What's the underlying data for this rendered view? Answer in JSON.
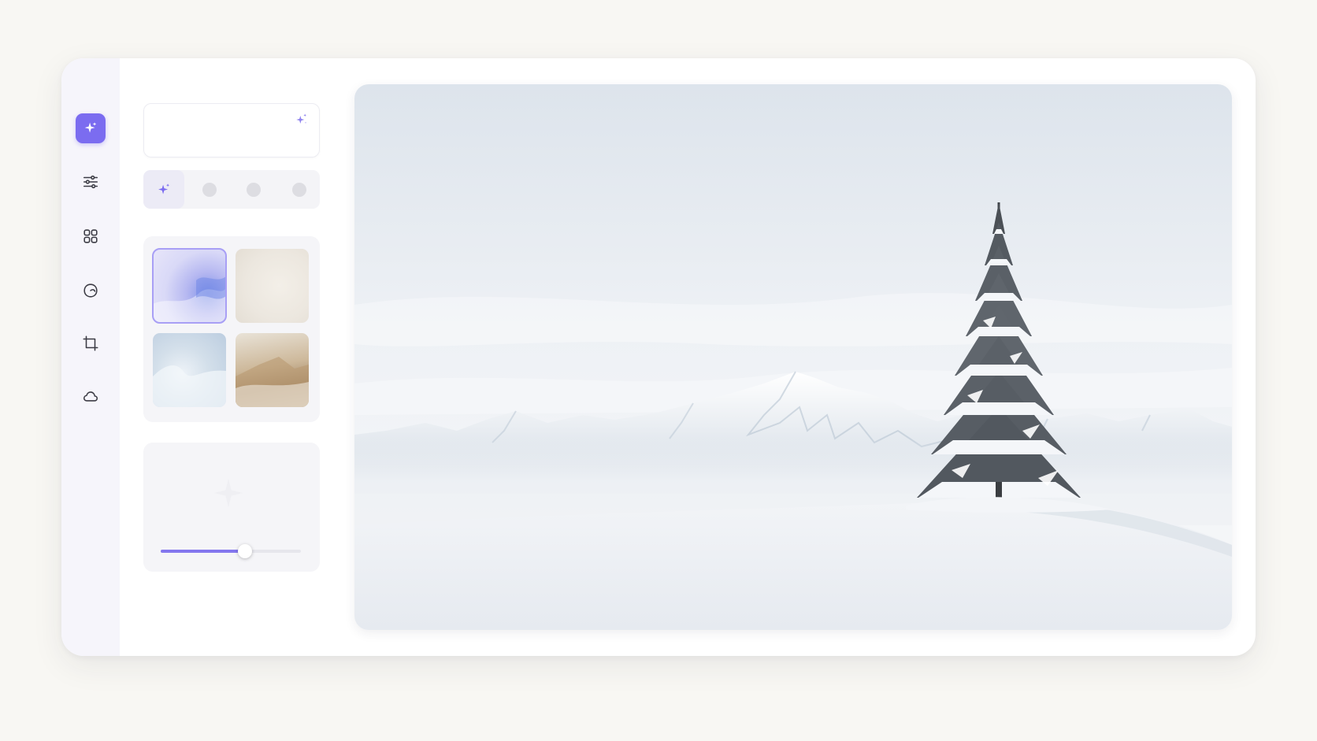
{
  "window": {
    "accent_color": "#7b6cf0"
  },
  "rail": {
    "items": [
      {
        "icon": "sparkle-icon",
        "active": true
      },
      {
        "icon": "sliders-icon",
        "active": false
      },
      {
        "icon": "grid-icon",
        "active": false
      },
      {
        "icon": "blob-shape-icon",
        "active": false
      },
      {
        "icon": "crop-icon",
        "active": false
      },
      {
        "icon": "cloud-icon",
        "active": false
      }
    ]
  },
  "prompt": {
    "value": "",
    "placeholder": "",
    "icon": "sparkle-icon"
  },
  "modes": {
    "active_icon": "sparkle-icon",
    "count": 4
  },
  "styles": {
    "thumbnails": [
      {
        "name": "lavender-haze",
        "selected": true
      },
      {
        "name": "cream-mist",
        "selected": false
      },
      {
        "name": "ice-blue",
        "selected": false
      },
      {
        "name": "desert-dunes",
        "selected": false
      }
    ]
  },
  "strength": {
    "value": 0.6
  },
  "preview": {
    "subject": "snowy-mountain-landscape-with-pine-tree"
  }
}
